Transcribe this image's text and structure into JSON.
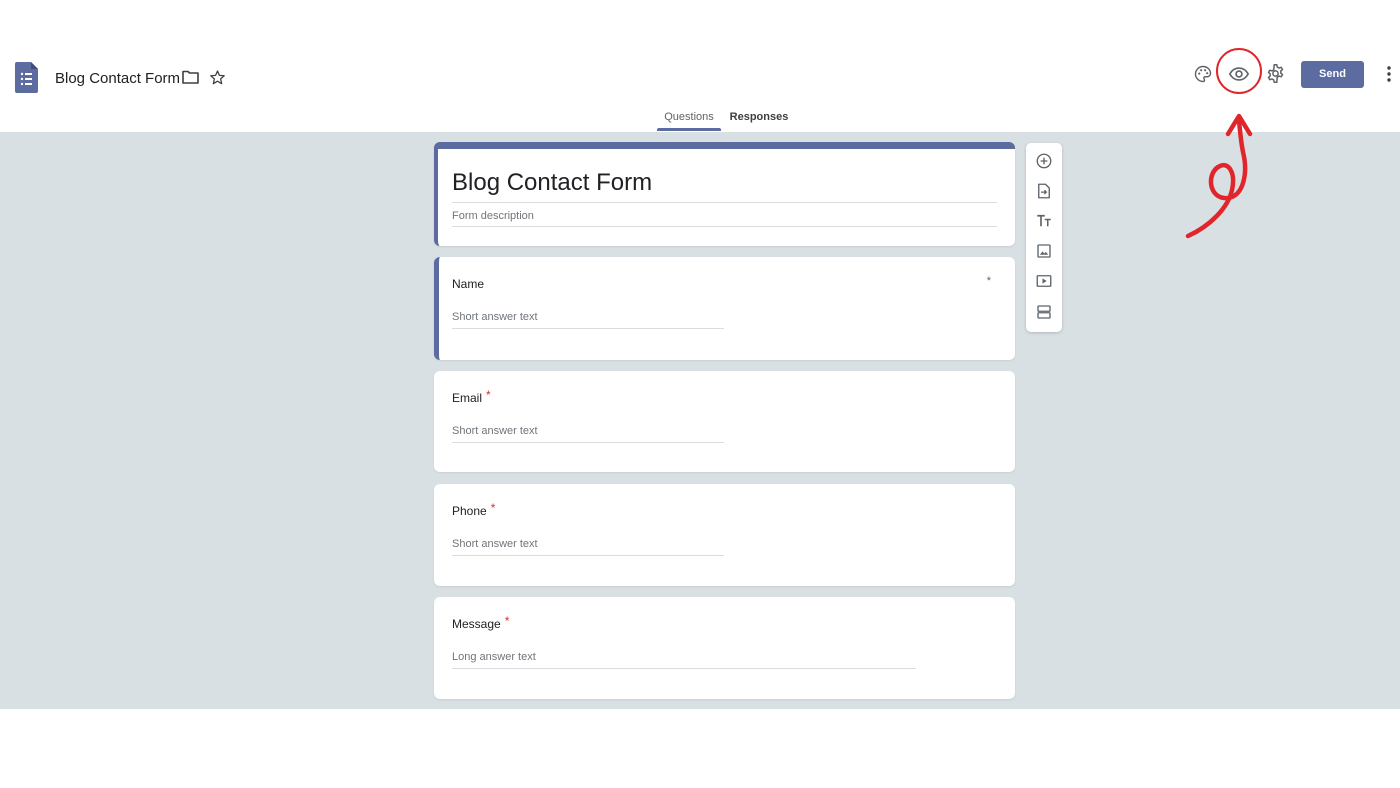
{
  "header": {
    "title": "Blog Contact Form",
    "send_label": "Send",
    "icons": [
      "forms-doc-icon",
      "folder-icon",
      "star-icon",
      "palette-icon",
      "eye-icon",
      "gear-icon",
      "more-vert-icon"
    ]
  },
  "tabs": [
    {
      "label": "Questions",
      "active": true
    },
    {
      "label": "Responses",
      "active": false
    }
  ],
  "form": {
    "title": "Blog Contact Form",
    "description_placeholder": "Form description"
  },
  "questions": [
    {
      "label": "Name",
      "required": true,
      "answer_hint": "Short answer text"
    },
    {
      "label": "Email",
      "required": true,
      "answer_hint": "Short answer text"
    },
    {
      "label": "Phone",
      "required": true,
      "answer_hint": "Short answer text"
    },
    {
      "label": "Message",
      "required": true,
      "answer_hint": "Long answer text"
    }
  ],
  "required_mark": "*",
  "toolbar": [
    "add-question-icon",
    "import-questions-icon",
    "add-title-icon",
    "add-image-icon",
    "add-video-icon",
    "add-section-icon"
  ],
  "colors": {
    "accent": "#5c6ba0",
    "background": "#d9e0e4",
    "annotation": "#e0262a"
  }
}
